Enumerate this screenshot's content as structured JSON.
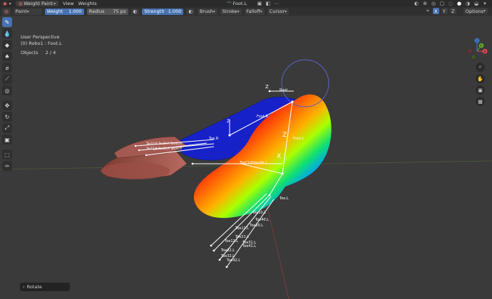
{
  "header": {
    "mode": "Weight Paint",
    "menus": [
      "View",
      "Weights"
    ],
    "active_bone": "Foot.L"
  },
  "tool_settings": {
    "blend_mode": "Paint",
    "weight_label": "Weight",
    "weight_value": "1.000",
    "radius_label": "Radius",
    "radius_value": "75 px",
    "strength_label": "Strength",
    "strength_value": "1.000",
    "brush": "Brush",
    "stroke": "Stroke",
    "falloff": "Falloff",
    "cursor": "Cursor",
    "options": "Options"
  },
  "viewport": {
    "perspective": "User Perspective",
    "context": "(0) Robo1 : Foot.L",
    "objects_label": "Objects",
    "objects_count": "2 / 4"
  },
  "gizmo": {
    "x_color": "#e04a57",
    "y_color": "#6aa624",
    "z_color": "#3f7ed9",
    "x": "X",
    "y": "Y",
    "z": "Z"
  },
  "bones": {
    "foot_r": "Foot.R",
    "foot_l": "Foot.L",
    "toe_l": "Toe.L",
    "toe10": "Toe10.L",
    "toe40": "Toe40.L",
    "toe11": "Toe11.L",
    "toe20": "Toe20.L",
    "toe31": "Toe31.L",
    "toe12": "Toe12.L",
    "toe21": "Toe21.L",
    "toe41": "Toe41.L",
    "toe22": "Toe22.L",
    "toe32": "Toe32.L",
    "toe42": "Toe42.L",
    "root": "Root",
    "pole": "ToeCtrlHandle.R",
    "pole_l": "ToeCtrlHandle.L"
  },
  "operator_panel": {
    "label": "Rotate"
  },
  "colors": {
    "accent": "#4772b3",
    "background": "#3a3a3a"
  }
}
